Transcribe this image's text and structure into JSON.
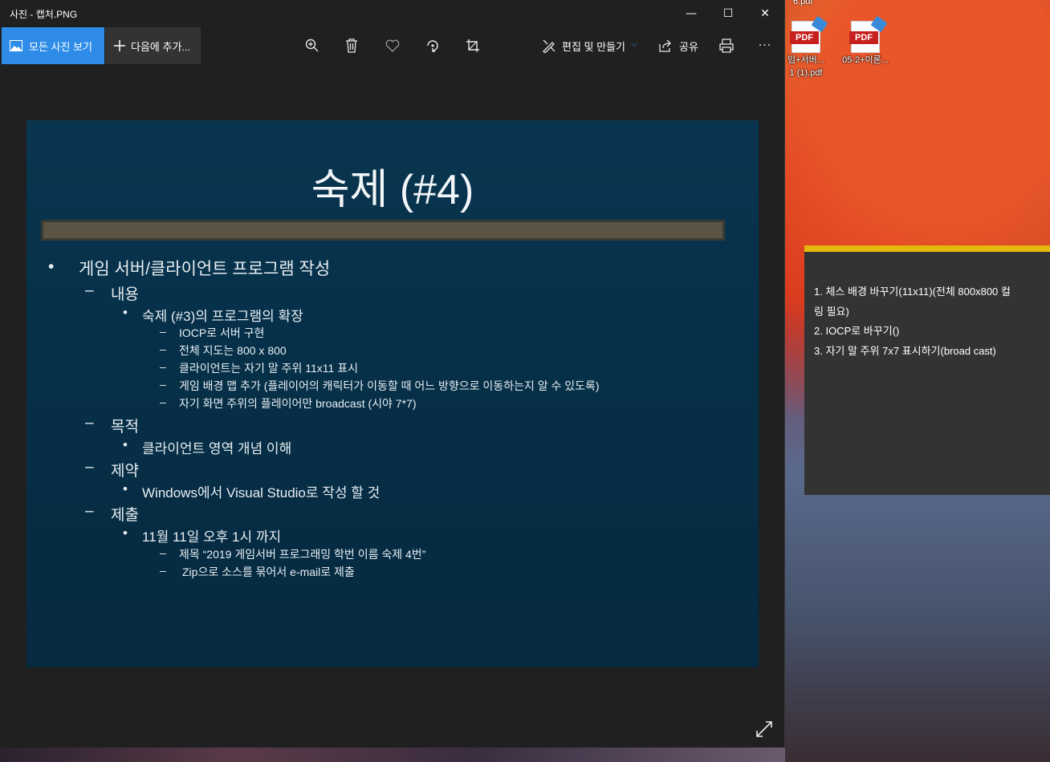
{
  "window": {
    "title": "사진 - 캡처.PNG",
    "controls": {
      "minimize": "—",
      "maximize": "☐",
      "close": "✕"
    }
  },
  "toolbar": {
    "all_photos_label": "모든 사진 보기",
    "add_to_label": "다음에 추가...",
    "edit_create_label": "편집 및 만들기",
    "share_label": "공유",
    "icons": [
      "image-icon",
      "plus-icon",
      "zoom-in-icon",
      "delete-icon",
      "favorite-icon",
      "rotate-icon",
      "crop-icon",
      "edit-icon",
      "share-icon",
      "print-icon",
      "more-icon"
    ],
    "more_label": "···",
    "accent_color": "#2e8ce8"
  },
  "slide": {
    "title": "숙제 (#4)",
    "bullets": [
      {
        "marker": "•",
        "text": "게임 서버/클라이언트 프로그램 작성"
      },
      {
        "marker": "–",
        "text": "내용"
      },
      {
        "marker": "•",
        "text": "숙제 (#3)의 프로그램의 확장"
      },
      {
        "marker": "–",
        "text": "IOCP로 서버 구현"
      },
      {
        "marker": "–",
        "text": "전체 지도는 800 x 800"
      },
      {
        "marker": "–",
        "text": "클라이언트는 자기 말 주위 11x11 표시"
      },
      {
        "marker": "–",
        "text": "게임 배경 맵 추가 (플레이어의 캐릭터가 이동할 때 어느 방향으로 이동하는지 알 수 있도록)"
      },
      {
        "marker": "–",
        "text": "자기 화면 주위의 플레이어만 broadcast (시야 7*7)"
      },
      {
        "marker": "–",
        "text": "목적"
      },
      {
        "marker": "•",
        "text": "클라이언트 영역 개념 이해"
      },
      {
        "marker": "–",
        "text": "제약"
      },
      {
        "marker": "•",
        "text": "Windows에서 Visual Studio로 작성 할 것"
      },
      {
        "marker": "–",
        "text": "제출"
      },
      {
        "marker": "•",
        "text": "11월 11일 오후 1시 까지"
      },
      {
        "marker": "–",
        "text": "제목 “2019 게임서버 프로그래밍 학번 이름 숙제 4번”"
      },
      {
        "marker": "–",
        "text": "Zip으로 소스를 묶어서 e-mail로 제출"
      }
    ]
  },
  "desktop": {
    "top_fragment": "6.pdf",
    "icons": [
      {
        "line1": "임+서버...",
        "line2": "1 (1).pdf",
        "type": "PDF"
      },
      {
        "line1": "05-2+이론...",
        "line2": "",
        "type": "PDF"
      }
    ]
  },
  "sticky_note": {
    "accent_color": "#e5b80b",
    "lines": [
      "1. 체스 배경 바꾸기(11x11)(전체 800x800 컬",
      "링 필요)",
      "2. IOCP로 바꾸기()",
      "3. 자기 말 주위 7x7 표시하기(broad cast)"
    ]
  }
}
